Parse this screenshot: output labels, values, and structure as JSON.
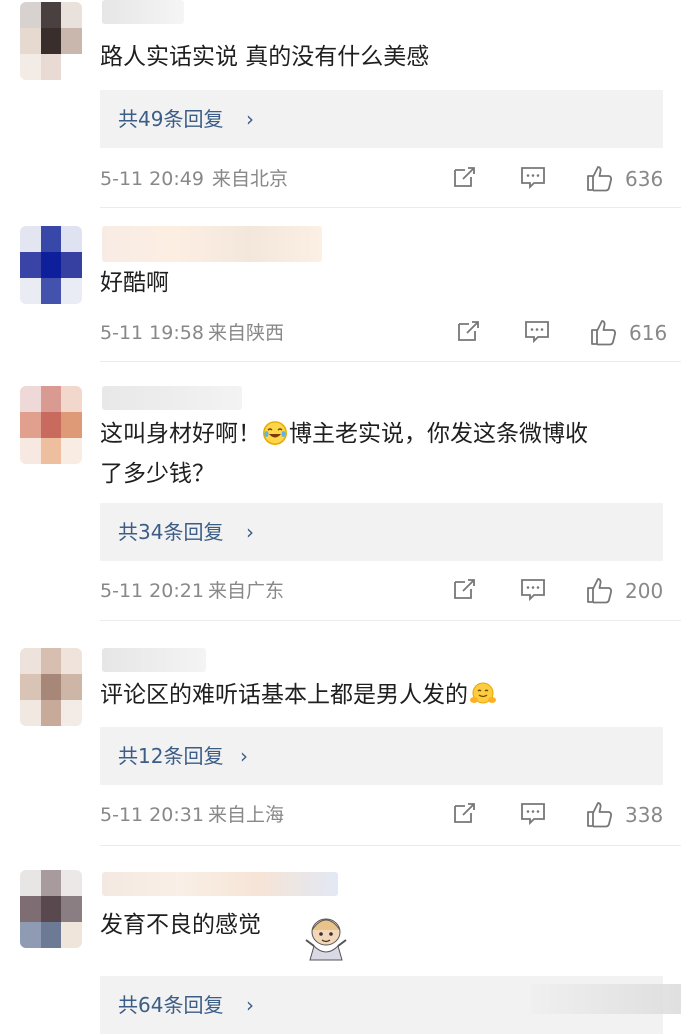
{
  "comments": [
    {
      "text": "路人实话实说 真的没有什么美感",
      "replies_label": "共49条回复",
      "time": "5-11 20:49",
      "location": "来自北京",
      "likes": "636"
    },
    {
      "text": "好酷啊",
      "time": "5-11 19:58",
      "location": "来自陕西",
      "likes": "616"
    },
    {
      "text_line1_a": "这叫身材好啊！",
      "text_line1_b": "博主老实说，你发这条微博收",
      "text_line2": "了多少钱？",
      "replies_label": "共34条回复",
      "time": "5-11 20:21",
      "location": "来自广东",
      "likes": "200"
    },
    {
      "text": "评论区的难听话基本上都是男人发的",
      "replies_label": "共12条回复",
      "time": "5-11 20:31",
      "location": "来自上海",
      "likes": "338"
    },
    {
      "text": "发育不良的感觉",
      "replies_label": "共64条回复"
    }
  ],
  "colors": {
    "link": "#3b5d86",
    "meta": "#888888",
    "reply_bg": "#f2f2f2"
  },
  "icons": [
    "share-icon",
    "comment-icon",
    "like-icon",
    "chevron-right-icon",
    "laughing-tears-emoji",
    "hugging-emoji"
  ]
}
